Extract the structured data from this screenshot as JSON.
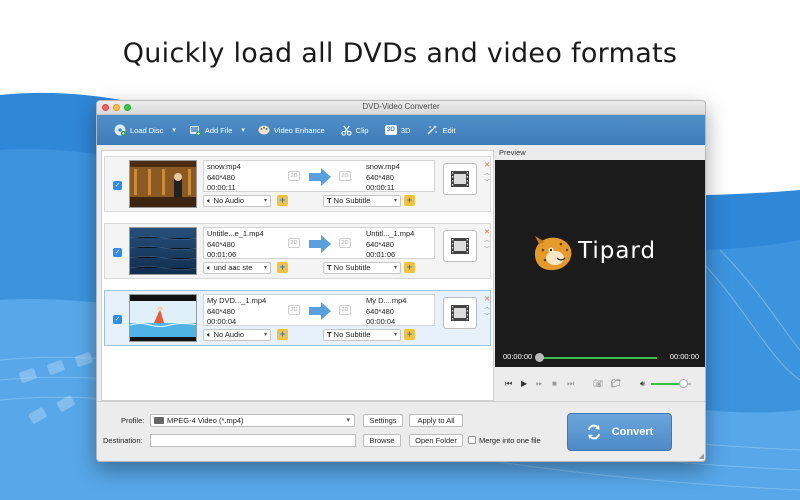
{
  "headline": "Quickly load all DVDs and video formats",
  "window": {
    "title": "DVD-Video Converter"
  },
  "toolbar": {
    "load_disc": "Load Disc",
    "add_file": "Add File",
    "video_enhance": "Video Enhance",
    "clip": "Clip",
    "three_d_badge": "3D",
    "three_d": "3D",
    "edit": "Edit"
  },
  "files": [
    {
      "src_name": "snow.mp4",
      "src_res": "640*480",
      "src_dur": "00:00:11",
      "dst_name": "snow.mp4",
      "dst_res": "640*480",
      "dst_dur": "00:00:11",
      "tag": "2D",
      "audio": "No Audio",
      "subtitle": "No Subtitle"
    },
    {
      "src_name": "Untitle...e_1.mp4",
      "src_res": "640*480",
      "src_dur": "00:01:06",
      "dst_name": "Untitl..._1.mp4",
      "dst_res": "640*480",
      "dst_dur": "00:01:06",
      "tag": "2D",
      "audio": "und aac ste",
      "subtitle": "No Subtitle"
    },
    {
      "src_name": "My DVD..._1.mp4",
      "src_res": "640*480",
      "src_dur": "00:00:04",
      "dst_name": "My D....mp4",
      "dst_res": "640*480",
      "dst_dur": "00:00:04",
      "tag": "2D",
      "audio": "No Audio",
      "subtitle": "No Subtitle"
    }
  ],
  "preview": {
    "label": "Preview",
    "logo": "Tipard",
    "time_current": "00:00:00",
    "time_total": "00:00:00",
    "progress": 0,
    "volume": 0.8
  },
  "bottom": {
    "profile_label": "Profile:",
    "profile_value": "MPEG-4 Video (*.mp4)",
    "settings": "Settings",
    "apply_to_all": "Apply to All",
    "destination_label": "Destination:",
    "destination_value": "",
    "browse": "Browse",
    "open_folder": "Open Folder",
    "merge_label": "Merge into one file",
    "convert": "Convert"
  },
  "colors": {
    "accent": "#3e7cb8",
    "convert": "#5a96d0",
    "progress": "#3cbf4a",
    "remove": "#e0662a"
  }
}
